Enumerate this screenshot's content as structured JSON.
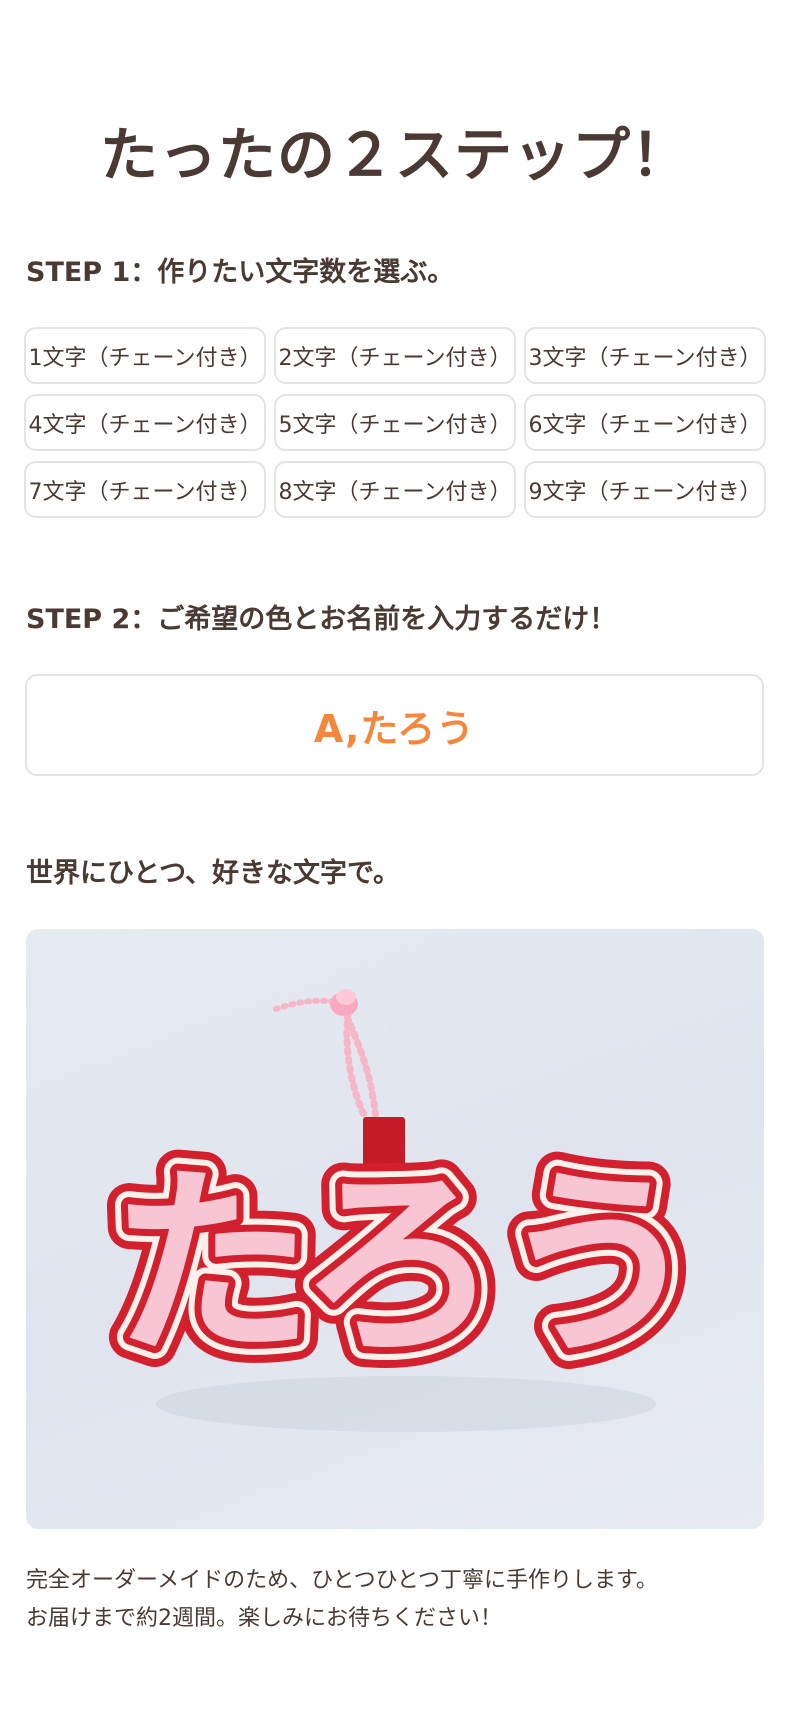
{
  "main_title": "たったの２ステップ！",
  "step1": {
    "heading": "STEP 1：作りたい文字数を選ぶ。",
    "options": [
      "1文字（チェーン付き）",
      "2文字（チェーン付き）",
      "3文字（チェーン付き）",
      "4文字（チェーン付き）",
      "5文字（チェーン付き）",
      "6文字（チェーン付き）",
      "7文字（チェーン付き）",
      "8文字（チェーン付き）",
      "9文字（チェーン付き）"
    ]
  },
  "step2": {
    "heading": "STEP 2：ご希望の色とお名前を入力するだけ！",
    "input_value": "A,たろう"
  },
  "tagline": "世界にひとつ、好きな文字で。",
  "product_photo": {
    "lettering": "たろう"
  },
  "description": {
    "line1": "完全オーダーメイドのため、ひとつひとつ丁寧に手作りします。",
    "line2": "お届けまで約2週間。楽しみにお待ちください！"
  },
  "colors": {
    "text": "#4a3a33",
    "accent_orange": "#f4873c",
    "border": "#e3e3e3",
    "felt_red": "#d2202e",
    "felt_pink": "#f7c6d2",
    "felt_cream": "#fbf1ea",
    "chain_pink": "#f7b6c8"
  }
}
